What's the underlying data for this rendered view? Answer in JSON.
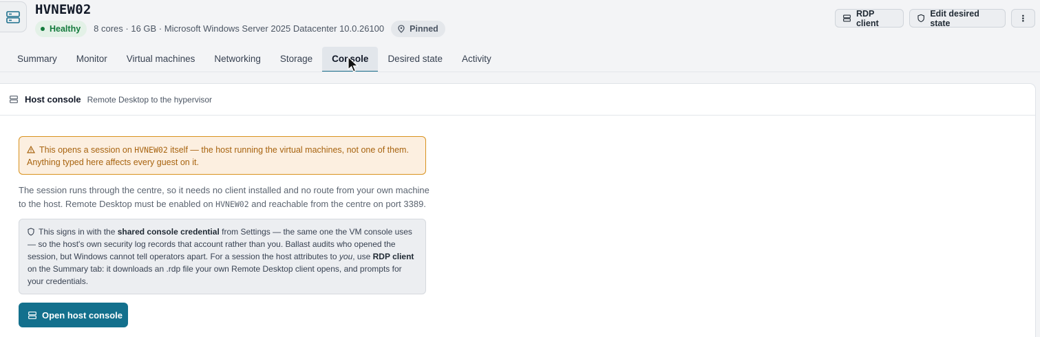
{
  "header": {
    "title": "HVNEW02",
    "status": "Healthy",
    "specs": "8 cores · 16 GB · Microsoft Windows Server 2025 Datacenter 10.0.26100",
    "pinned": "Pinned",
    "host_icon": "server-icon"
  },
  "actions": {
    "rdp_client": "RDP client",
    "edit_desired_state": "Edit desired state",
    "more": "⋮"
  },
  "tabs": [
    {
      "label": "Summary"
    },
    {
      "label": "Monitor"
    },
    {
      "label": "Virtual machines"
    },
    {
      "label": "Networking"
    },
    {
      "label": "Storage"
    },
    {
      "label": "Console",
      "active": true
    },
    {
      "label": "Desired state"
    },
    {
      "label": "Activity"
    }
  ],
  "panel": {
    "title": "Host console",
    "subtitle": "Remote Desktop to the hypervisor",
    "warning": {
      "pre": "This opens a session on ",
      "host": "HVNEW02",
      "post": " itself — the host running the virtual machines, not one of them.",
      "line2": "Anything typed here affects every guest on it."
    },
    "paragraph": {
      "line1": "The session runs through the centre, so it needs no client installed and no route from your own machine",
      "line2_pre": "to the host. Remote Desktop must be enabled on ",
      "host": "HVNEW02",
      "line2_post": " and reachable from the centre on port 3389."
    },
    "info": {
      "t1": "This signs in with the ",
      "b1": "shared console credential",
      "t2": " from Settings — the same one the VM console uses — so the host's own security log records that account rather than you. Ballast audits who opened the session, but Windows cannot tell operators apart. For a session the host attributes to ",
      "i1": "you",
      "t3": ", use ",
      "b2": "RDP client",
      "t4": " on the Summary tab: it downloads an .rdp file your own Remote Desktop client opens, and prompts for your credentials."
    },
    "open_button": "Open host console"
  },
  "colors": {
    "accent": "#13708d",
    "healthy": "#137a3c",
    "warning": "#d8911c"
  }
}
